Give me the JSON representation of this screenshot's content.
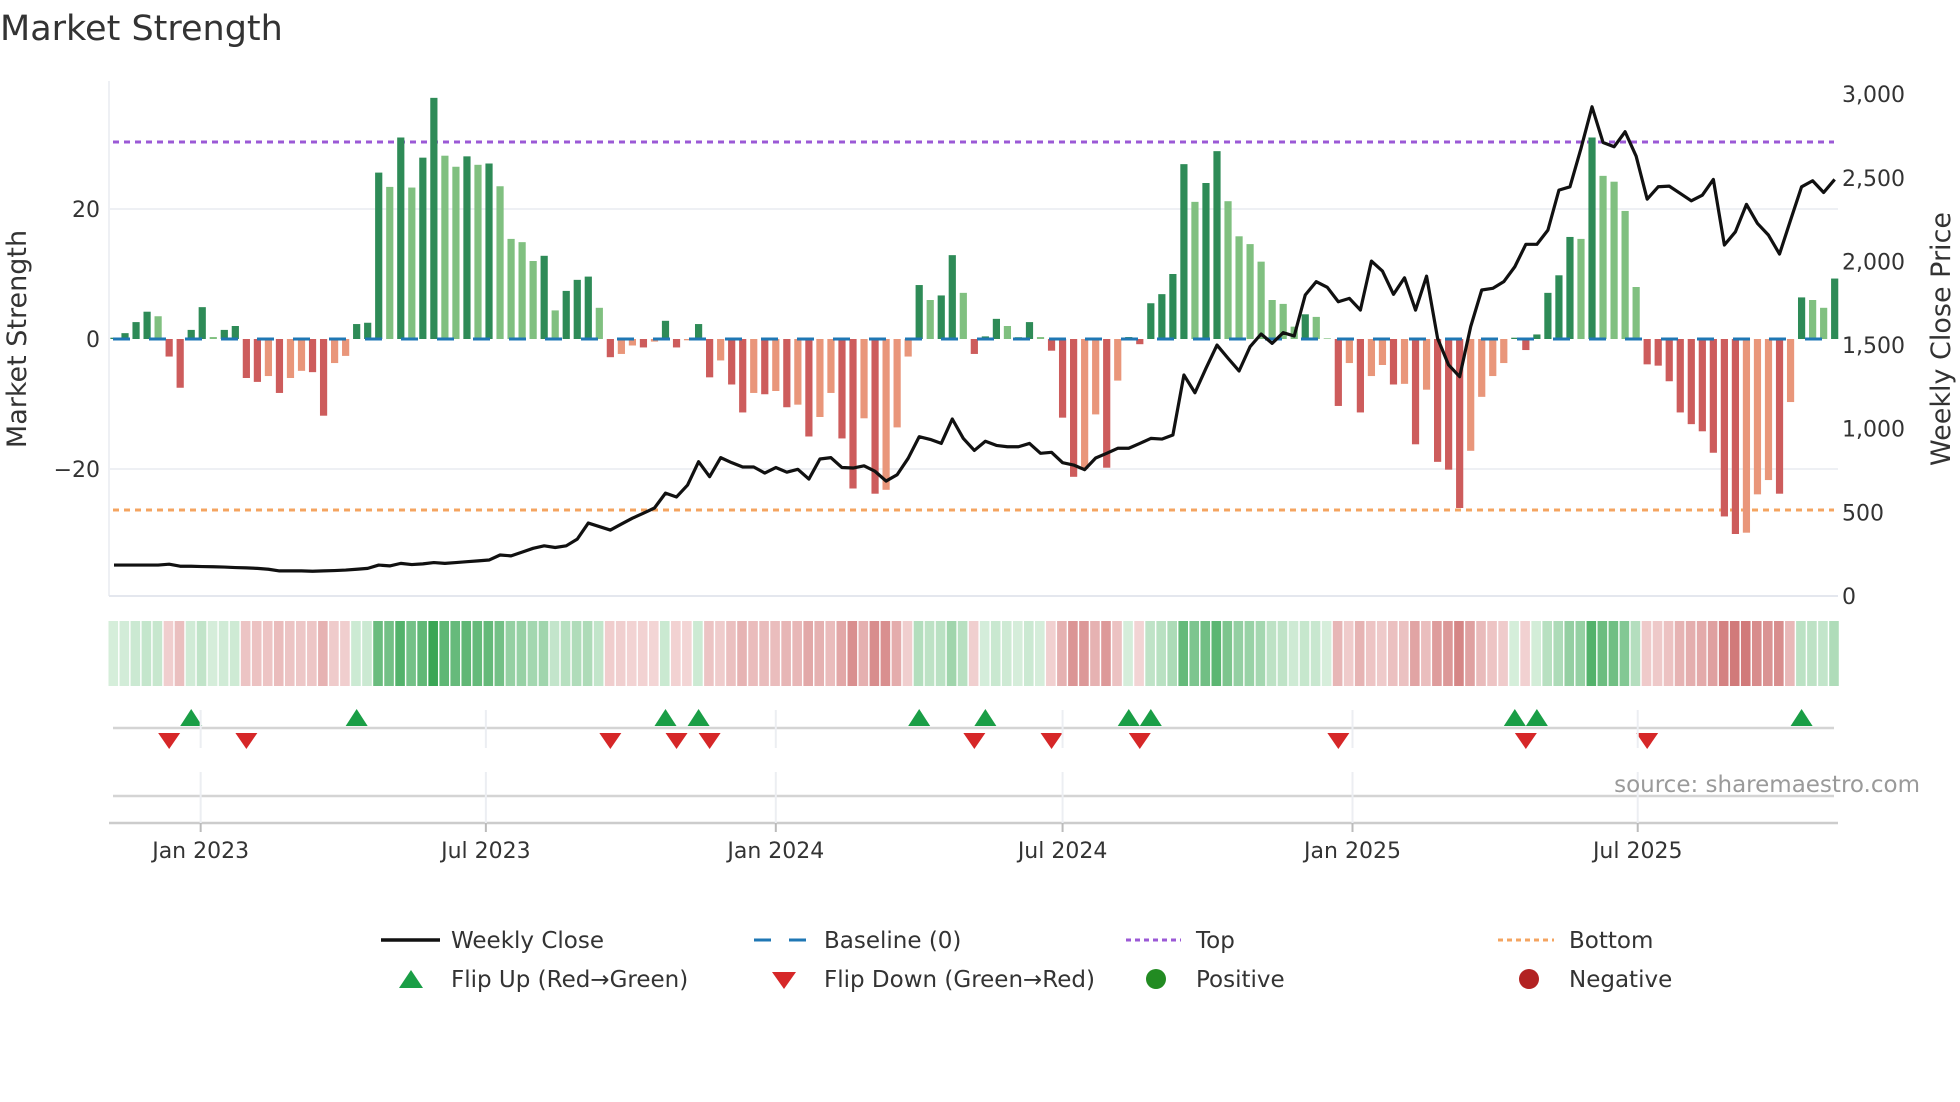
{
  "chart_data": {
    "type": "bar",
    "title": "Market Strength",
    "ylabel": "Market Strength",
    "y2label": "Weekly Close Price",
    "ylim": [
      -39.5,
      40.5
    ],
    "y2lim": [
      0,
      3000
    ],
    "yticks": [
      "20",
      "0",
      "−20"
    ],
    "ytick_values": [
      20,
      0,
      -20
    ],
    "y2ticks": [
      "3,000",
      "2,500",
      "2,000",
      "1,500",
      "1,000",
      "500",
      "0"
    ],
    "y2tick_values": [
      3000,
      2500,
      2000,
      1500,
      1000,
      500,
      0
    ],
    "frequency": "weekly",
    "start_date": "2022-11-07",
    "xticks": [
      {
        "label": "Jan 2023",
        "date": "2023-01-01"
      },
      {
        "label": "Jul 2023",
        "date": "2023-07-01"
      },
      {
        "label": "Jan 2024",
        "date": "2024-01-01"
      },
      {
        "label": "Jul 2024",
        "date": "2024-07-01"
      },
      {
        "label": "Jan 2025",
        "date": "2025-01-01"
      },
      {
        "label": "Jul 2025",
        "date": "2025-07-01"
      }
    ],
    "top_level": 30.3,
    "bottom_level": -26.3,
    "baseline": 0,
    "series": [
      {
        "name": "Market Strength",
        "axis": "left",
        "values": [
          0.2,
          0.9,
          2.6,
          4.2,
          3.5,
          -2.7,
          -7.5,
          1.4,
          4.9,
          0.3,
          1.4,
          2.0,
          -6.0,
          -6.6,
          -5.7,
          -8.3,
          -6.0,
          -4.9,
          -5.1,
          -11.8,
          -3.7,
          -2.6,
          2.3,
          2.5,
          25.6,
          23.4,
          31.0,
          23.3,
          27.9,
          37.1,
          28.2,
          26.5,
          28.1,
          26.8,
          27.0,
          23.5,
          15.4,
          14.9,
          12.0,
          12.8,
          4.4,
          7.4,
          9.1,
          9.6,
          4.8,
          -2.8,
          -2.3,
          -1.0,
          -1.3,
          -0.4,
          2.8,
          -1.3,
          -0.2,
          2.3,
          -5.9,
          -3.3,
          -7.0,
          -11.3,
          -8.3,
          -8.5,
          -8.0,
          -10.5,
          -10.1,
          -15.0,
          -12.0,
          -8.3,
          -15.3,
          -23.0,
          -12.2,
          -23.8,
          -23.2,
          -13.6,
          -2.7,
          8.3,
          6.0,
          6.7,
          12.9,
          7.1,
          -2.3,
          0.4,
          3.1,
          2.0,
          0.3,
          2.6,
          0.3,
          -1.8,
          -12.1,
          -21.2,
          -20.0,
          -11.6,
          -19.8,
          -6.4,
          0.3,
          -0.8,
          5.5,
          6.9,
          10.0,
          26.9,
          21.1,
          24.0,
          28.9,
          21.2,
          15.8,
          14.6,
          11.9,
          6.0,
          5.4,
          1.9,
          3.8,
          3.4,
          0.1,
          -10.3,
          -3.7,
          -11.3,
          -5.7,
          -4.0,
          -7.0,
          -6.9,
          -16.2,
          -7.8,
          -18.9,
          -20.1,
          -26.0,
          -17.2,
          -8.9,
          -5.7,
          -3.7,
          0.2,
          -1.7,
          0.7,
          7.1,
          9.8,
          15.7,
          15.4,
          31.0,
          25.1,
          24.2,
          19.7,
          8.0,
          -3.9,
          -4.1,
          -6.5,
          -11.3,
          -13.1,
          -14.2,
          -17.5,
          -27.3,
          -30.0,
          -29.8,
          -23.9,
          -21.7,
          -23.8,
          -9.7,
          6.4,
          6.0,
          4.8,
          9.3
        ]
      },
      {
        "name": "Weekly Close",
        "axis": "right",
        "values": [
          185,
          185,
          185,
          185,
          185,
          190,
          178,
          178,
          176,
          175,
          173,
          170,
          168,
          165,
          160,
          150,
          150,
          150,
          148,
          150,
          152,
          155,
          160,
          165,
          185,
          180,
          195,
          188,
          192,
          200,
          195,
          200,
          205,
          210,
          215,
          245,
          240,
          262,
          285,
          300,
          290,
          300,
          340,
          436,
          415,
          394,
          430,
          465,
          495,
          526,
          615,
          592,
          663,
          803,
          713,
          827,
          797,
          771,
          771,
          735,
          768,
          740,
          757,
          699,
          819,
          827,
          768,
          765,
          778,
          745,
          687,
          725,
          823,
          952,
          936,
          912,
          1058,
          942,
          870,
          925,
          900,
          892,
          892,
          912,
          853,
          859,
          797,
          783,
          755,
          825,
          853,
          883,
          883,
          912,
          942,
          938,
          962,
          1321,
          1215,
          1361,
          1500,
          1421,
          1345,
          1490,
          1566,
          1510,
          1574,
          1554,
          1799,
          1879,
          1845,
          1759,
          1779,
          1709,
          2002,
          1942,
          1803,
          1902,
          1709,
          1912,
          1540,
          1381,
          1311,
          1610,
          1829,
          1839,
          1879,
          1968,
          2102,
          2102,
          2187,
          2426,
          2446,
          2675,
          2924,
          2711,
          2685,
          2775,
          2629,
          2372,
          2446,
          2450,
          2406,
          2362,
          2396,
          2490,
          2098,
          2177,
          2341,
          2227,
          2157,
          2044,
          2247,
          2446,
          2482,
          2412,
          2490
        ]
      }
    ],
    "legend": {
      "placement": "bottom",
      "items": [
        {
          "label": "Weekly Close",
          "marker": "line"
        },
        {
          "label": "Baseline (0)",
          "marker": "dashed"
        },
        {
          "label": "Top",
          "marker": "dotted"
        },
        {
          "label": "Bottom",
          "marker": "dotted"
        },
        {
          "label": "Flip Up (Red→Green)",
          "marker": "triangle-up"
        },
        {
          "label": "Flip Down (Green→Red)",
          "marker": "triangle-down"
        },
        {
          "label": "Positive",
          "marker": "circle"
        },
        {
          "label": "Negative",
          "marker": "circle"
        }
      ]
    },
    "annotation": "source: sharemaestro.com"
  },
  "colors": {
    "pos_rising": "#2e8b57",
    "pos_falling": "#80c080",
    "neg_falling": "#cd5c5c",
    "neg_rising": "#e9967a",
    "top": "#9b59d6",
    "bottom": "#f4a460",
    "baseline": "#1f77b4",
    "close": "#111111",
    "flip_up": "#1a9e46",
    "flip_down": "#d62728",
    "positive": "#228b22",
    "negative": "#b22222"
  }
}
